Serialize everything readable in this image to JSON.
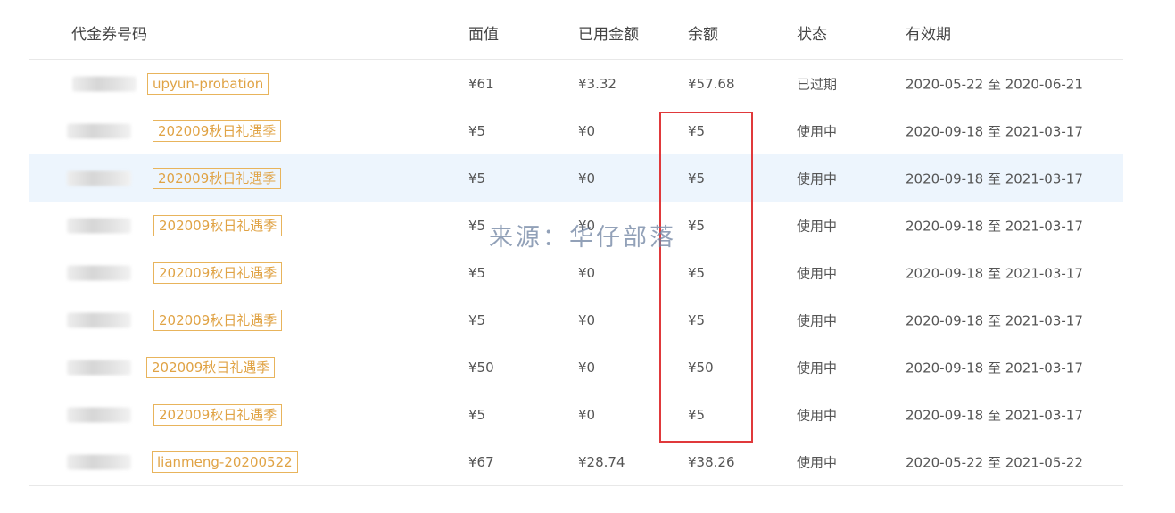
{
  "columns": {
    "code": "代金券号码",
    "face_value": "面值",
    "used": "已用金额",
    "balance": "余额",
    "status": "状态",
    "validity": "有效期"
  },
  "rows": [
    {
      "tag": "upyun-probation",
      "face": "¥61",
      "used": "¥3.32",
      "balance": "¥57.68",
      "status": "已过期",
      "validity": "2020-05-22 至 2020-06-21"
    },
    {
      "tag": "202009秋日礼遇季",
      "face": "¥5",
      "used": "¥0",
      "balance": "¥5",
      "status": "使用中",
      "validity": "2020-09-18 至 2021-03-17"
    },
    {
      "tag": "202009秋日礼遇季",
      "face": "¥5",
      "used": "¥0",
      "balance": "¥5",
      "status": "使用中",
      "validity": "2020-09-18 至 2021-03-17"
    },
    {
      "tag": "202009秋日礼遇季",
      "face": "¥5",
      "used": "¥0",
      "balance": "¥5",
      "status": "使用中",
      "validity": "2020-09-18 至 2021-03-17"
    },
    {
      "tag": "202009秋日礼遇季",
      "face": "¥5",
      "used": "¥0",
      "balance": "¥5",
      "status": "使用中",
      "validity": "2020-09-18 至 2021-03-17"
    },
    {
      "tag": "202009秋日礼遇季",
      "face": "¥5",
      "used": "¥0",
      "balance": "¥5",
      "status": "使用中",
      "validity": "2020-09-18 至 2021-03-17"
    },
    {
      "tag": "202009秋日礼遇季",
      "face": "¥50",
      "used": "¥0",
      "balance": "¥50",
      "status": "使用中",
      "validity": "2020-09-18 至 2021-03-17"
    },
    {
      "tag": "202009秋日礼遇季",
      "face": "¥5",
      "used": "¥0",
      "balance": "¥5",
      "status": "使用中",
      "validity": "2020-09-18 至 2021-03-17"
    },
    {
      "tag": "lianmeng-20200522",
      "face": "¥67",
      "used": "¥28.74",
      "balance": "¥38.26",
      "status": "使用中",
      "validity": "2020-05-22 至 2021-05-22"
    }
  ],
  "watermark": "来源：华仔部落",
  "colors": {
    "tag_border": "#e8b45c",
    "tag_text": "#e0a345",
    "highlight_row": "#edf5fd",
    "annotation_box": "#e0393b"
  }
}
